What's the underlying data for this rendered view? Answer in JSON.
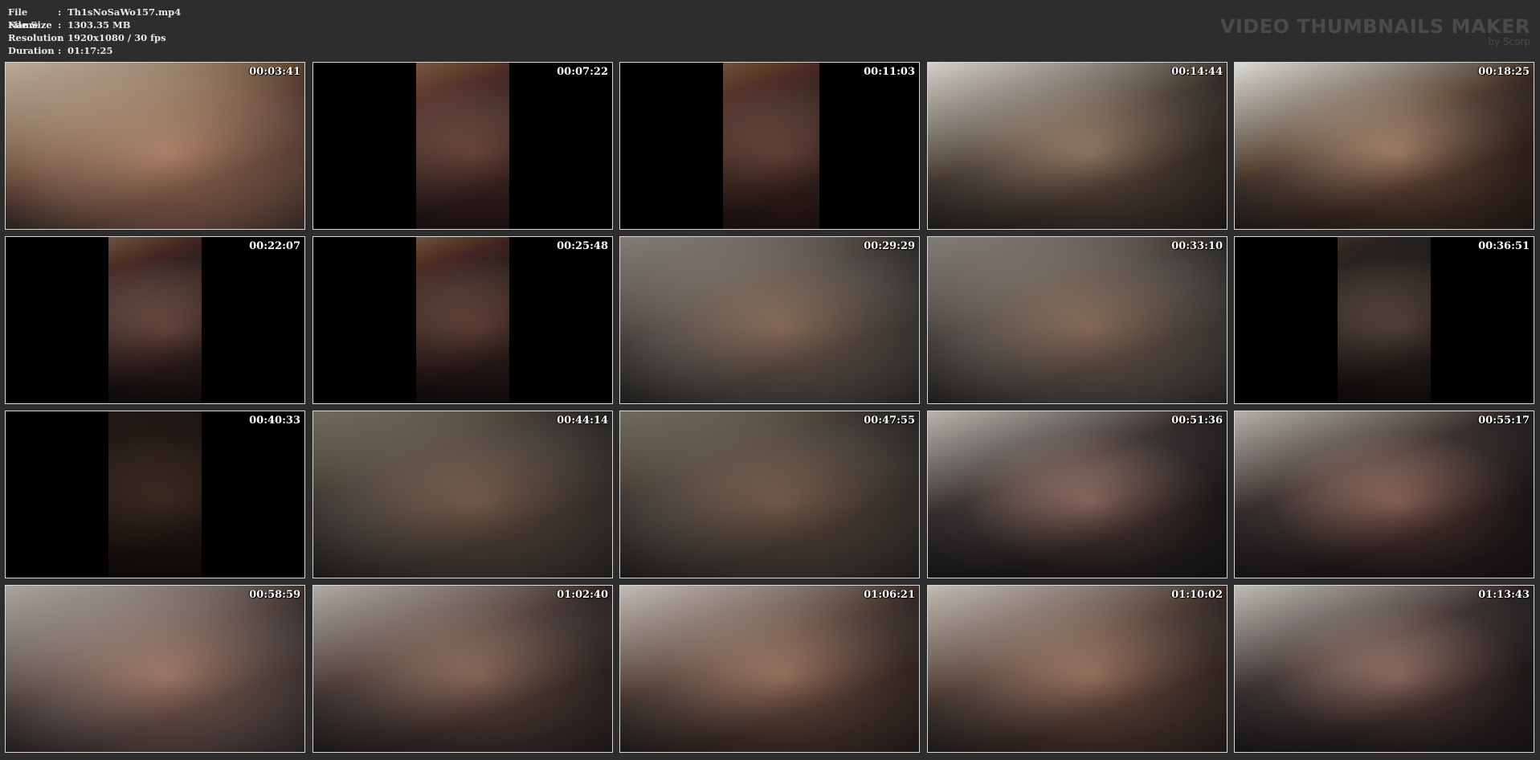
{
  "file_info": [
    {
      "key": "File Name",
      "value": "Th1sNoSaWo157.mp4"
    },
    {
      "key": "File Size",
      "value": "1303.35 MB"
    },
    {
      "key": "Resolution",
      "value": "1920x1080 / 30 fps"
    },
    {
      "key": "Duration",
      "value": "01:17:25"
    }
  ],
  "separator": ":",
  "brand": {
    "title": "VIDEO THUMBNAILS MAKER",
    "subtitle": "by Scorp"
  },
  "thumbnails": [
    {
      "time": "00:03:41",
      "colors": [
        "#6a5a52",
        "#a88c7a",
        "#d9d0c4"
      ],
      "bars": "none"
    },
    {
      "time": "00:07:22",
      "colors": [
        "#3b2f2f",
        "#8c6e62",
        "#c9b7a9"
      ],
      "bars": "portrait"
    },
    {
      "time": "00:11:03",
      "colors": [
        "#3a2e2c",
        "#866b60",
        "#c4b3a6"
      ],
      "bars": "portrait-left"
    },
    {
      "time": "00:14:44",
      "colors": [
        "#4a443f",
        "#a08a78",
        "#e8e6e2"
      ],
      "bars": "none"
    },
    {
      "time": "00:18:25",
      "colors": [
        "#4a3f38",
        "#b09684",
        "#ecece8"
      ],
      "bars": "none"
    },
    {
      "time": "00:22:07",
      "colors": [
        "#2e2626",
        "#9a7c70",
        "#c8b8ac"
      ],
      "bars": "portrait"
    },
    {
      "time": "00:25:48",
      "colors": [
        "#2e2626",
        "#8c6e62",
        "#c9b7a9"
      ],
      "bars": "portrait"
    },
    {
      "time": "00:29:29",
      "colors": [
        "#55524f",
        "#9a7e6c",
        "#b9b6b2"
      ],
      "bars": "none"
    },
    {
      "time": "00:33:10",
      "colors": [
        "#55524f",
        "#9a7e6c",
        "#b9b6b2"
      ],
      "bars": "none"
    },
    {
      "time": "00:36:51",
      "colors": [
        "#2a2624",
        "#8c7a70",
        "#a8a29a"
      ],
      "bars": "portrait"
    },
    {
      "time": "00:40:33",
      "colors": [
        "#2a2420",
        "#6e5a50",
        "#8a7a70"
      ],
      "bars": "portrait"
    },
    {
      "time": "00:44:14",
      "colors": [
        "#4e4a46",
        "#8e7464",
        "#b0aca6"
      ],
      "bars": "none"
    },
    {
      "time": "00:47:55",
      "colors": [
        "#4e4a46",
        "#8e7464",
        "#b0aca6"
      ],
      "bars": "none"
    },
    {
      "time": "00:51:36",
      "colors": [
        "#3a3636",
        "#b08c80",
        "#d8d6d2"
      ],
      "bars": "none"
    },
    {
      "time": "00:55:17",
      "colors": [
        "#3a3434",
        "#b08878",
        "#d6d4d0"
      ],
      "bars": "none"
    },
    {
      "time": "00:58:59",
      "colors": [
        "#5a5250",
        "#a88878",
        "#d0ccc8"
      ],
      "bars": "none"
    },
    {
      "time": "01:02:40",
      "colors": [
        "#4a4240",
        "#a08474",
        "#d4d0cc"
      ],
      "bars": "none"
    },
    {
      "time": "01:06:21",
      "colors": [
        "#4e4440",
        "#a88a78",
        "#dedad6"
      ],
      "bars": "none"
    },
    {
      "time": "01:10:02",
      "colors": [
        "#4e4440",
        "#a88a78",
        "#dedad6"
      ],
      "bars": "none"
    },
    {
      "time": "01:13:43",
      "colors": [
        "#3e3838",
        "#b08e80",
        "#dcdad6"
      ],
      "bars": "none"
    }
  ]
}
